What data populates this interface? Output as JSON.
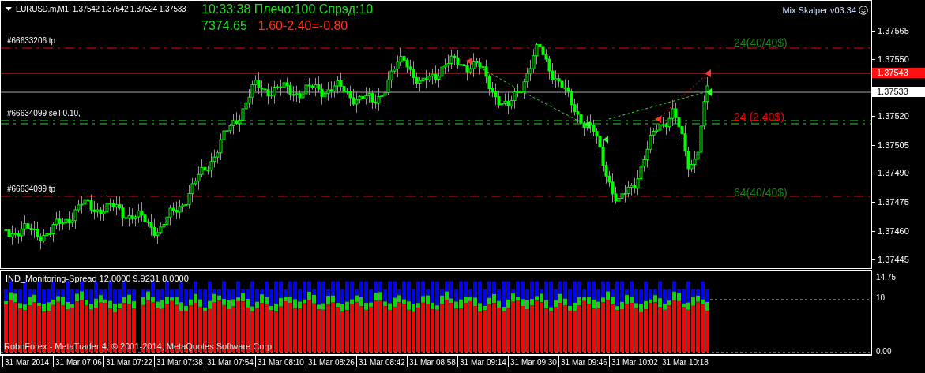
{
  "chart": {
    "symbol": "EURUSD.m,M1",
    "ohlc": "1.37542 1.37542 1.37524 1.37533"
  },
  "info_panel": {
    "status": "10:33:38 Плечо:100 Спрэд:10",
    "balance": "7374.65",
    "result": "1.60-2.40=-0.80"
  },
  "expert": {
    "name": "Mix Skalper v03.34"
  },
  "order_lines": [
    {
      "kind": "take_profit",
      "label": "#66633206 tp",
      "note": "24(40/40$)",
      "color": "#1e7d1e"
    },
    {
      "kind": "open_order",
      "label": "#66634099 sell 0.10,",
      "note": "24 (2.40$)",
      "color": "#ff0000"
    },
    {
      "kind": "take_profit",
      "label": "#66634099 tp",
      "note": "64(40/40$)",
      "color": "#1e7d1e"
    }
  ],
  "price_axis": {
    "ticks": [
      "1.37565",
      "1.37550",
      "1.37520",
      "1.37505",
      "1.37490",
      "1.37475",
      "1.37460",
      "1.37445"
    ],
    "ask": "1.37543",
    "bid": "1.37533"
  },
  "indicator": {
    "title": "IND_Monitoring-Spread 12.0000 9.9231 8.0000",
    "axis": [
      "14.75",
      "10",
      "0.00"
    ]
  },
  "copyright": "RoboForex - MetaTrader 4, © 2001-2014, MetaQuotes Software Corp.",
  "time_axis": [
    "31 Mar 2014",
    "31 Mar 07:06",
    "31 Mar 07:22",
    "31 Mar 07:38",
    "31 Mar 07:54",
    "31 Mar 08:10",
    "31 Mar 08:26",
    "31 Mar 08:42",
    "31 Mar 08:58",
    "31 Mar 09:14",
    "31 Mar 09:30",
    "31 Mar 09:46",
    "31 Mar 10:02",
    "31 Mar 10:18"
  ]
}
